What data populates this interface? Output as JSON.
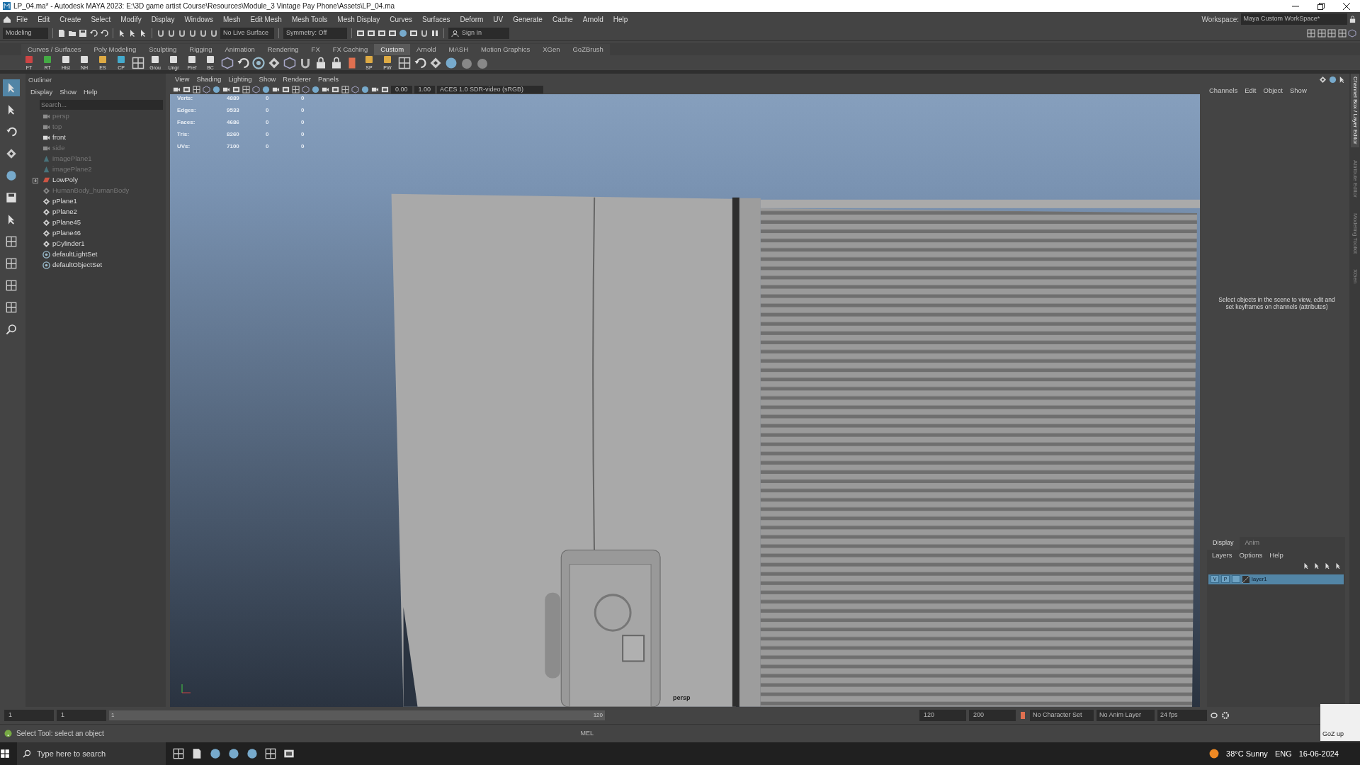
{
  "title_bar": {
    "title": "LP_04.ma* - Autodesk MAYA 2023: E:\\3D game artist Course\\Resources\\Module_3 Vintage Pay Phone\\Assets\\LP_04.ma"
  },
  "menu_bar": [
    "File",
    "Edit",
    "Create",
    "Select",
    "Modify",
    "Display",
    "Windows",
    "Mesh",
    "Edit Mesh",
    "Mesh Tools",
    "Mesh Display",
    "Curves",
    "Surfaces",
    "Deform",
    "UV",
    "Generate",
    "Cache",
    "Arnold",
    "Help"
  ],
  "workspace": {
    "label": "Workspace:",
    "value": "Maya Custom WorkSpace*"
  },
  "status_line": {
    "mode": "Modeling",
    "live_surface": "No Live Surface",
    "symmetry": "Symmetry: Off",
    "sign_in": "Sign In"
  },
  "shelf": {
    "tabs": [
      {
        "label": "Curves / Surfaces",
        "selected": false
      },
      {
        "label": "Poly Modeling",
        "selected": false
      },
      {
        "label": "Sculpting",
        "selected": false
      },
      {
        "label": "Rigging",
        "selected": false
      },
      {
        "label": "Animation",
        "selected": false
      },
      {
        "label": "Rendering",
        "selected": false
      },
      {
        "label": "FX",
        "selected": false
      },
      {
        "label": "FX Caching",
        "selected": false
      },
      {
        "label": "Custom",
        "selected": true
      },
      {
        "label": "Arnold",
        "selected": false
      },
      {
        "label": "MASH",
        "selected": false
      },
      {
        "label": "Motion Graphics",
        "selected": false
      },
      {
        "label": "XGen",
        "selected": false
      },
      {
        "label": "GoZBrush",
        "selected": false
      }
    ],
    "buttons": [
      "FT",
      "RT",
      "Hist",
      "NH",
      "ES",
      "CP",
      "Grou",
      "Ungr",
      "Pref",
      "BC",
      "SP",
      "PW"
    ]
  },
  "outliner": {
    "title": "Outliner",
    "menu": [
      "Display",
      "Show",
      "Help"
    ],
    "search": {
      "placeholder": "Search..."
    },
    "items": [
      {
        "label": "persp",
        "kind": "camera",
        "hidden": true
      },
      {
        "label": "top",
        "kind": "camera",
        "hidden": true
      },
      {
        "label": "front",
        "kind": "camera",
        "hidden": false
      },
      {
        "label": "side",
        "kind": "camera",
        "hidden": true
      },
      {
        "label": "imagePlane1",
        "kind": "image",
        "hidden": true
      },
      {
        "label": "imagePlane2",
        "kind": "image",
        "hidden": true
      },
      {
        "label": "LowPoly",
        "kind": "group",
        "hidden": false,
        "expanded": false
      },
      {
        "label": "HumanBody_humanBody",
        "kind": "mesh",
        "hidden": true
      },
      {
        "label": "pPlane1",
        "kind": "mesh",
        "hidden": false
      },
      {
        "label": "pPlane2",
        "kind": "mesh",
        "hidden": false
      },
      {
        "label": "pPlane45",
        "kind": "mesh",
        "hidden": false
      },
      {
        "label": "pPlane46",
        "kind": "mesh",
        "hidden": false
      },
      {
        "label": "pCylinder1",
        "kind": "mesh",
        "hidden": false
      },
      {
        "label": "defaultLightSet",
        "kind": "set",
        "hidden": false
      },
      {
        "label": "defaultObjectSet",
        "kind": "set",
        "hidden": false
      }
    ]
  },
  "viewport": {
    "menu": [
      "View",
      "Shading",
      "Lighting",
      "Show",
      "Renderer",
      "Panels"
    ],
    "exposure": "0.00",
    "gamma": "1.00",
    "color_space": "ACES 1.0 SDR-video (sRGB)",
    "hud": [
      {
        "label": "Verts:",
        "values": [
          "4889",
          "0",
          "0"
        ]
      },
      {
        "label": "Edges:",
        "values": [
          "9533",
          "0",
          "0"
        ]
      },
      {
        "label": "Faces:",
        "values": [
          "4686",
          "0",
          "0"
        ]
      },
      {
        "label": "Tris:",
        "values": [
          "8260",
          "0",
          "0"
        ]
      },
      {
        "label": "UVs:",
        "values": [
          "7100",
          "0",
          "0"
        ]
      }
    ],
    "camera": "persp"
  },
  "channel_box": {
    "menu": [
      "Channels",
      "Edit",
      "Object",
      "Show"
    ],
    "message": "Select objects in the scene to view, edit and set keyframes on channels (attributes)"
  },
  "side_tabs": [
    {
      "label": "Channel Box / Layer Editor",
      "selected": true
    },
    {
      "label": "Attribute Editor",
      "selected": false
    },
    {
      "label": "Modeling Toolkit",
      "selected": false
    },
    {
      "label": "XGen",
      "selected": false
    }
  ],
  "layer_editor": {
    "tabs": [
      {
        "label": "Display",
        "selected": true
      },
      {
        "label": "Anim",
        "selected": false
      }
    ],
    "menu": [
      "Layers",
      "Options",
      "Help"
    ],
    "layers": [
      {
        "name": "layer1",
        "visible": "V",
        "playback": "P",
        "selected": true
      }
    ]
  },
  "time_slider": {
    "start": "1",
    "range_start": "1",
    "slider_start": "1",
    "slider_end": "120",
    "range_end": "120",
    "end": "200",
    "character_set": "No Character Set",
    "anim_layer": "No Anim Layer",
    "fps": "24 fps"
  },
  "help_line": {
    "text": "Select Tool: select an object",
    "command_type": "MEL"
  },
  "goz_popup": {
    "text": "GoZ up"
  },
  "taskbar": {
    "search_placeholder": "Type here to search",
    "weather": "38°C  Sunny",
    "language": "ENG",
    "date": "16-06-2024"
  }
}
